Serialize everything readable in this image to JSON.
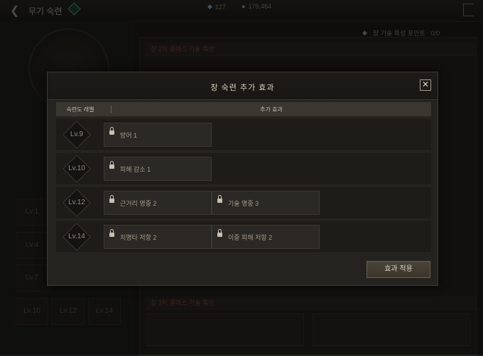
{
  "topbar": {
    "title": "무기 숙련",
    "gems": "127",
    "coins": "179,464"
  },
  "background": {
    "point_label": "창 기술 특성 포인트",
    "point_value": "0/0",
    "section_top": "창 2차 클래스 기술 특성",
    "section_bottom": "창 3차 클래스 기술 특성",
    "left_levels": [
      "Lv.1",
      "Lv.4",
      "Lv.7",
      "Lv.10",
      "Lv.12",
      "Lv.14"
    ]
  },
  "modal": {
    "title": "창 숙련 추가 효과",
    "col_level": "숙련도 레벨",
    "col_effect": "추가 효과",
    "rows": [
      {
        "level": "Lv.9",
        "effects": [
          "방어 1"
        ]
      },
      {
        "level": "Lv.10",
        "effects": [
          "피해 감소 1"
        ]
      },
      {
        "level": "Lv.12",
        "effects": [
          "근거리 명중 2",
          "기술 명중 3"
        ]
      },
      {
        "level": "Lv.14",
        "effects": [
          "치명타 저항 2",
          "이중 피해 저항 2"
        ]
      }
    ],
    "apply_label": "효과 적용"
  },
  "colors": {
    "accent_red": "#7a3b33",
    "gem_green": "#4e8a6a",
    "panel": "#25231f"
  }
}
